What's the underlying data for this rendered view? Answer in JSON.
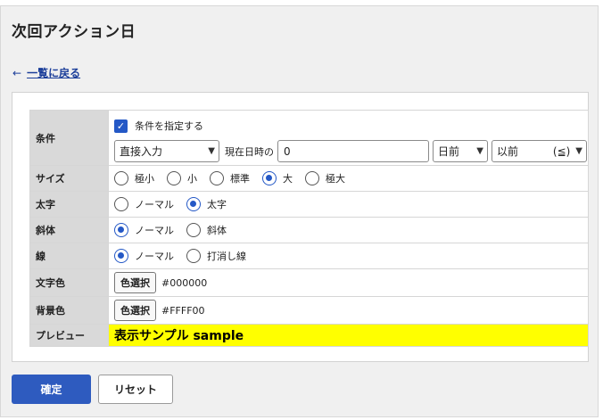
{
  "page": {
    "title": "次回アクション日",
    "back_link": "一覧に戻る",
    "back_arrow": "←"
  },
  "form": {
    "condition": {
      "label": "条件",
      "checkbox_label": "条件を指定する",
      "checked": true,
      "input_type_value": "直接入力",
      "base_text": "現在日時の",
      "number_value": "0",
      "unit_value": "日前",
      "compare_value": "以前",
      "compare_symbol": "(≦)"
    },
    "size": {
      "label": "サイズ",
      "options": [
        "極小",
        "小",
        "標準",
        "大",
        "極大"
      ],
      "selected": "大"
    },
    "bold": {
      "label": "太字",
      "options": [
        "ノーマル",
        "太字"
      ],
      "selected": "太字"
    },
    "italic": {
      "label": "斜体",
      "options": [
        "ノーマル",
        "斜体"
      ],
      "selected": "ノーマル"
    },
    "line": {
      "label": "線",
      "options": [
        "ノーマル",
        "打消し線"
      ],
      "selected": "ノーマル"
    },
    "text_color": {
      "label": "文字色",
      "button": "色選択",
      "value": "#000000"
    },
    "bg_color": {
      "label": "背景色",
      "button": "色選択",
      "value": "#FFFF00"
    },
    "preview": {
      "label": "プレビュー",
      "text": "表示サンプル sample",
      "bg": "#FFFF00"
    }
  },
  "footer": {
    "confirm": "確定",
    "reset": "リセット"
  },
  "colors": {
    "accent": "#2458c6",
    "confirm_button": "#2e5bbf",
    "label_bg": "#d9d9d9"
  }
}
